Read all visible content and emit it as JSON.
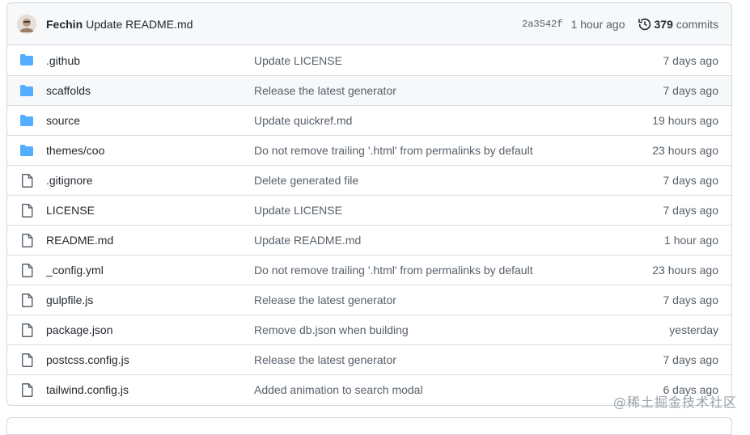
{
  "commit": {
    "author": "Fechin",
    "message": "Update README.md",
    "sha": "2a3542f",
    "time": "1 hour ago",
    "commit_count": "379",
    "commit_label": "commits"
  },
  "files": [
    {
      "type": "folder",
      "name": ".github",
      "message": "Update LICENSE",
      "time": "7 days ago"
    },
    {
      "type": "folder",
      "name": "scaffolds",
      "message": "Release the latest generator",
      "time": "7 days ago"
    },
    {
      "type": "folder",
      "name": "source",
      "message": "Update quickref.md",
      "time": "19 hours ago"
    },
    {
      "type": "folder",
      "name": "themes/coo",
      "message": "Do not remove trailing '.html' from permalinks by default",
      "time": "23 hours ago"
    },
    {
      "type": "file",
      "name": ".gitignore",
      "message": "Delete generated file",
      "time": "7 days ago"
    },
    {
      "type": "file",
      "name": "LICENSE",
      "message": "Update LICENSE",
      "time": "7 days ago"
    },
    {
      "type": "file",
      "name": "README.md",
      "message": "Update README.md",
      "time": "1 hour ago"
    },
    {
      "type": "file",
      "name": "_config.yml",
      "message": "Do not remove trailing '.html' from permalinks by default",
      "time": "23 hours ago"
    },
    {
      "type": "file",
      "name": "gulpfile.js",
      "message": "Release the latest generator",
      "time": "7 days ago"
    },
    {
      "type": "file",
      "name": "package.json",
      "message": "Remove db.json when building",
      "time": "yesterday"
    },
    {
      "type": "file",
      "name": "postcss.config.js",
      "message": "Release the latest generator",
      "time": "7 days ago"
    },
    {
      "type": "file",
      "name": "tailwind.config.js",
      "message": "Added animation to search modal",
      "time": "6 days ago"
    }
  ],
  "watermark": "@稀土掘金技术社区",
  "colors": {
    "folder": "#54aeff",
    "file": "#57606a",
    "border": "#d0d7de"
  }
}
